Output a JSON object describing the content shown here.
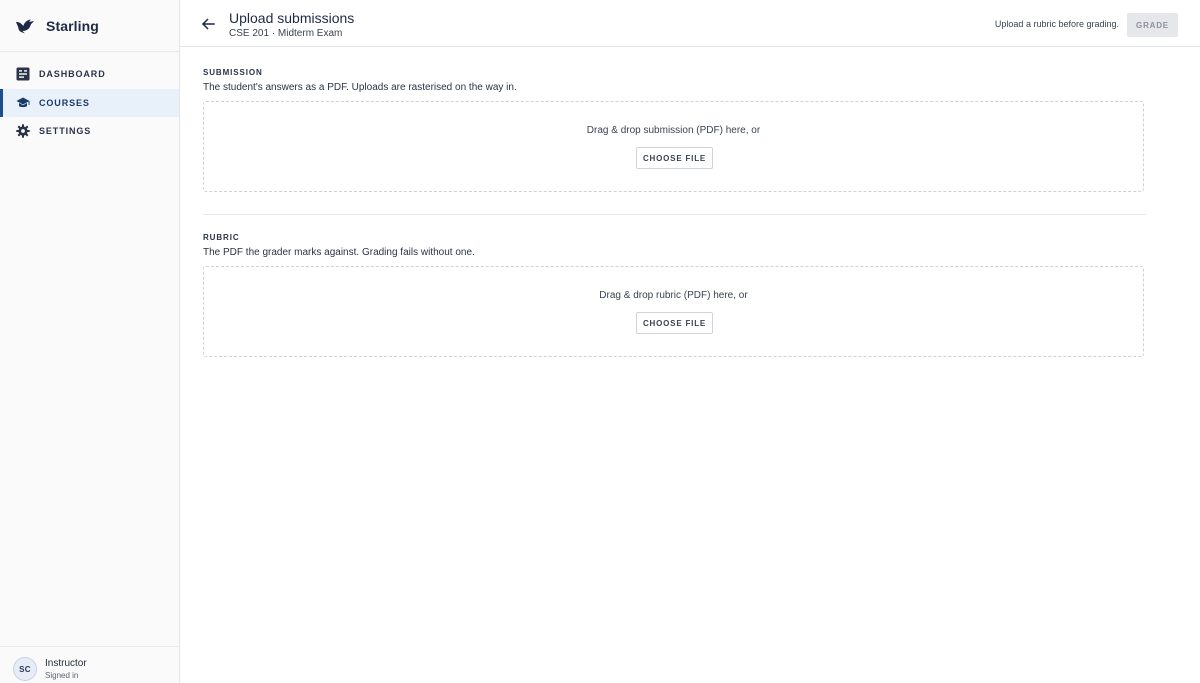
{
  "app": {
    "name": "Starling"
  },
  "sidebar": {
    "items": [
      {
        "label": "DASHBOARD",
        "icon": "dashboard-icon",
        "active": false
      },
      {
        "label": "COURSES",
        "icon": "school-icon",
        "active": true
      },
      {
        "label": "SETTINGS",
        "icon": "gear-icon",
        "active": false
      }
    ],
    "user": {
      "initials": "SC",
      "role": "Instructor",
      "status": "Signed in"
    }
  },
  "header": {
    "title": "Upload submissions",
    "subtitle": "CSE 201 · Midterm Exam",
    "hint": "Upload a rubric before grading.",
    "grade_label": "GRADE",
    "grade_enabled": false
  },
  "submission": {
    "label": "SUBMISSION",
    "description": "The student's answers as a PDF. Uploads are rasterised on the way in.",
    "dropzone_text": "Drag & drop submission (PDF) here, or",
    "button_label": "CHOOSE FILE"
  },
  "rubric": {
    "label": "RUBRIC",
    "description": "The PDF the grader marks against. Grading fails without one.",
    "dropzone_text": "Drag & drop rubric (PDF) here, or",
    "button_label": "CHOOSE FILE"
  },
  "colors": {
    "accent": "#1a4f8c",
    "active_bg": "#e8f0fa",
    "disabled_bg": "#e5e7ea",
    "text": "#1f2a37"
  }
}
